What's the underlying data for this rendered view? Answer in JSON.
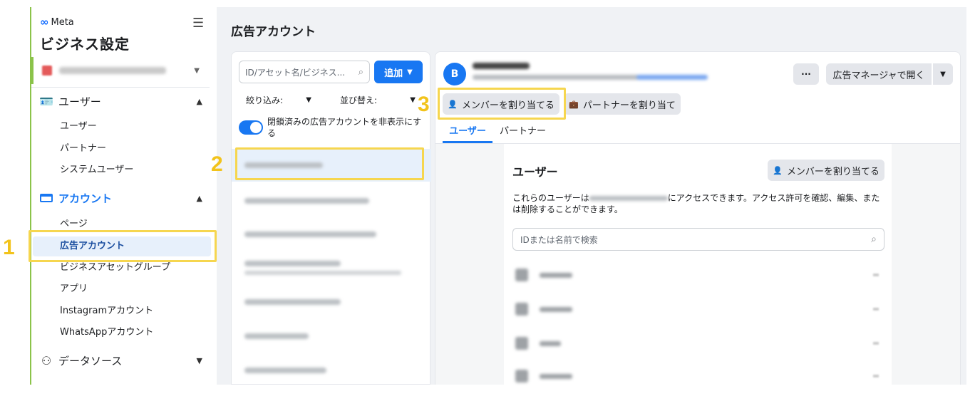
{
  "sidebar": {
    "logo_text": "Meta",
    "title": "ビジネス設定",
    "menu_icon": "hamburger-icon",
    "sections": {
      "users": {
        "label": "ユーザー",
        "icon": "user-badge-icon",
        "items": [
          "ユーザー",
          "パートナー",
          "システムユーザー"
        ]
      },
      "accounts": {
        "label": "アカウント",
        "icon": "folder-icon",
        "items": [
          "ページ",
          "広告アカウント",
          "ビジネスアセットグループ",
          "アプリ",
          "Instagramアカウント",
          "WhatsAppアカウント"
        ]
      },
      "datasources": {
        "label": "データソース",
        "icon": "datasource-icon"
      }
    }
  },
  "main": {
    "title": "広告アカウント",
    "search_placeholder": "ID/アセット名/ビジネス...",
    "add_label": "追加",
    "filter_label": "絞り込み:",
    "sort_label": "並び替え:",
    "toggle_label": "閉鎖済みの広告アカウントを非表示にする"
  },
  "panel": {
    "avatar_letter": "B",
    "more_label": "···",
    "open_label": "広告マネージャで開く",
    "assign_member_label": "メンバーを割り当てる",
    "assign_partner_label": "パートナーを割り当て",
    "tabs": [
      "ユーザー",
      "パートナー"
    ],
    "users_title": "ユーザー",
    "users_assign_label": "メンバーを割り当てる",
    "users_desc_prefix": "これらのユーザーは",
    "users_desc_suffix": "にアクセスできます。アクセス許可を確認、編集、または削除することができます。",
    "user_search_placeholder": "IDまたは名前で検索"
  },
  "annotations": {
    "n1": "1",
    "n2": "2",
    "n3": "3"
  },
  "colors": {
    "accent": "#1877f2",
    "highlight": "#f6d64f",
    "annotation_number": "#f2c31b"
  }
}
